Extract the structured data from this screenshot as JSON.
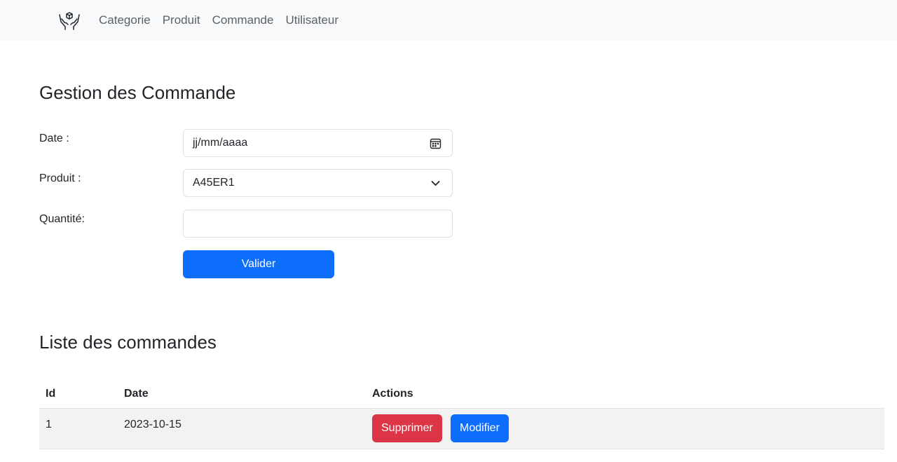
{
  "navbar": {
    "brand_icon": "hands-box-icon",
    "links": [
      "Categorie",
      "Produit",
      "Commande",
      "Utilisateur"
    ]
  },
  "form": {
    "title": "Gestion des Commande",
    "date_label": "Date :",
    "date_placeholder": "jj/mm/aaaa",
    "produit_label": "Produit :",
    "produit_value": "A45ER1",
    "quantite_label": "Quantité:",
    "quantite_value": "",
    "submit_label": "Valider"
  },
  "list": {
    "title": "Liste des commandes",
    "columns": [
      "Id",
      "Date",
      "Actions"
    ],
    "rows": [
      {
        "id": "1",
        "date": "2023-10-15",
        "delete_label": "Supprimer",
        "edit_label": "Modifier"
      }
    ]
  },
  "colors": {
    "primary": "#0d6efd",
    "danger": "#dc3545",
    "navbar_bg": "#f8f9fa",
    "row_striped": "#f2f2f2"
  }
}
